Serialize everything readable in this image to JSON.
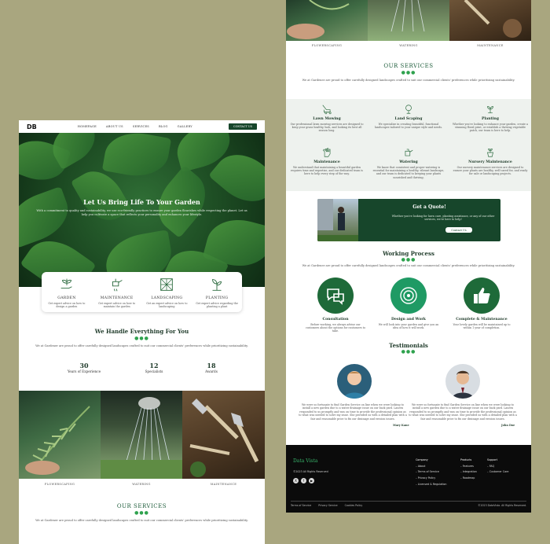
{
  "colors": {
    "background": "#a9a67f",
    "primary": "#17462b",
    "accent_green": "#2fa24e",
    "dark_footer": "#0b0b0b"
  },
  "nav": {
    "logo": "DB",
    "links": [
      "HOMEPAGE",
      "ABOUT US",
      "SERVICES",
      "BLOG",
      "GALLERY"
    ],
    "cta": "CONTACT US"
  },
  "hero": {
    "title": "Let Us Bring Life To Your Garden",
    "subtitle": "With a commitment to quality and sustainability, we use eco-friendly practices to ensure your garden flourishes while respecting the planet. Let us help you cultivate a space that reflects your personality and enhances your lifestyle."
  },
  "service_strip": [
    {
      "name": "GARDEN",
      "desc": "Get expert advice on how to design a garden",
      "icon": "plant-hand-icon"
    },
    {
      "name": "MAINTENANCE",
      "desc": "Get expert advice on how to maintain the garden",
      "icon": "watering-icon"
    },
    {
      "name": "LANDSCAPING",
      "desc": "Get an expert advice on how to landscaping",
      "icon": "landscape-icon"
    },
    {
      "name": "PLANTING",
      "desc": "Get expert advice regarding the planting a plant",
      "icon": "seedling-icon"
    }
  ],
  "handle": {
    "title": "We Handle Everything For You",
    "desc": "We at Gardener are proud to offer carefully designed landscapes crafted to suit our commercial clients' preferences while prioritizing sustainability."
  },
  "stats": [
    {
      "value": "30",
      "label": "Years of Experience"
    },
    {
      "value": "12",
      "label": "Specialists"
    },
    {
      "value": "18",
      "label": "Awards"
    }
  ],
  "gallery_captions": [
    "FLOWERSCAPING",
    "WATERING",
    "MAINTENANCE"
  ],
  "our_services": {
    "title": "OUR SERVICES",
    "desc": "We at Gardener are proud to offer carefully designed landscapes crafted to suit our commercial clients' preferences while prioritizing sustainability."
  },
  "services_grid": [
    {
      "name": "Lawn Mowing",
      "desc": "Our professional lawn mowing services are designed to keep your grass healthy, lush, and looking its best all season long.",
      "icon": "mower-icon"
    },
    {
      "name": "Land Scaping",
      "desc": "We specialize in creating beautiful, functional landscapes tailored to your unique style and needs.",
      "icon": "tree-icon"
    },
    {
      "name": "Planting",
      "desc": "Whether you're looking to enhance your garden, create a stunning floral print, or establish a thriving vegetable patch, our team is here to help.",
      "icon": "sprout-icon"
    },
    {
      "name": "Maintenance",
      "desc": "We understand that maintaining a beautiful garden requires time and expertise, and our dedicated team is here to help every step of the way.",
      "icon": "glove-icon"
    },
    {
      "name": "Watering",
      "desc": "We know that consistent and proper watering is essential for maintaining a healthy, vibrant landscape, and our team is dedicated to keeping your plants nourished and thriving.",
      "icon": "can-icon"
    },
    {
      "name": "Nursery Maintenance",
      "desc": "Our nursery maintenance services are designed to ensure your plants are healthy, well-cared for, and ready for sale or landscaping projects.",
      "icon": "pot-icon"
    }
  ],
  "quote": {
    "title": "Get a Quote!",
    "desc": "Whether you're looking for lawn care, planting assistance, or any of our other services, we're here to help!",
    "button": "Contact Us"
  },
  "process": {
    "title": "Working Process",
    "desc": "We at Gardener are proud to offer carefully designed landscapes crafted to suit our commercial clients' preferences while prioritizing sustainability.",
    "steps": [
      {
        "name": "Consultation",
        "desc": "Before working, we always advise our customers about the options for customers to take.",
        "icon": "chat-icon"
      },
      {
        "name": "Design and Work",
        "desc": "We will look into your garden and give you an idea of how it will work.",
        "icon": "target-icon"
      },
      {
        "name": "Complete & Maintenance",
        "desc": "Your lovely garden will be maintained up to within 1 year of completion.",
        "icon": "thumbs-up-icon"
      }
    ]
  },
  "testimonials": {
    "title": "Testimonials",
    "items": [
      {
        "quote": "We were so fortunate to find Garden Service on line when we were looking to install a new garden due to a water drainage issue on our back yard. Lauren responded to us promptly and was on time to provide the professional opinion as to what was needed to solve my issue. She provided us with a detailed plan with a fair and reasonable price to fix our drainage and erosion issues.",
        "name": "Mary Kane"
      },
      {
        "quote": "We were so fortunate to find Garden Service on line when we were looking to install a new garden due to a water drainage issue on our back yard. Lauren responded to us promptly and was on time to provide the professional opinion as to what was needed to solve my issue. She provided us with a detailed plan with a fair and reasonable price to fix our drainage and erosion issues.",
        "name": "John Doe"
      }
    ]
  },
  "footer": {
    "brand": "Data Vista",
    "copyright": "©2023 All Rights Reserved",
    "social": [
      "X",
      "f",
      "▶"
    ],
    "columns": [
      {
        "heading": "Company",
        "links": [
          "About",
          "Terms of Service",
          "Privacy Policy",
          "Licensed & Regulation"
        ]
      },
      {
        "heading": "Products",
        "links": [
          "Features",
          "Integration",
          "Roadmap"
        ]
      },
      {
        "heading": "Support",
        "links": [
          "FAQ",
          "Customer Care"
        ]
      }
    ],
    "bottom_links": [
      "Terms of Service",
      "Privacy Service",
      "Cookies Policy"
    ],
    "bottom_copyright": "©2023 DataVista. All Rights Reserved."
  }
}
